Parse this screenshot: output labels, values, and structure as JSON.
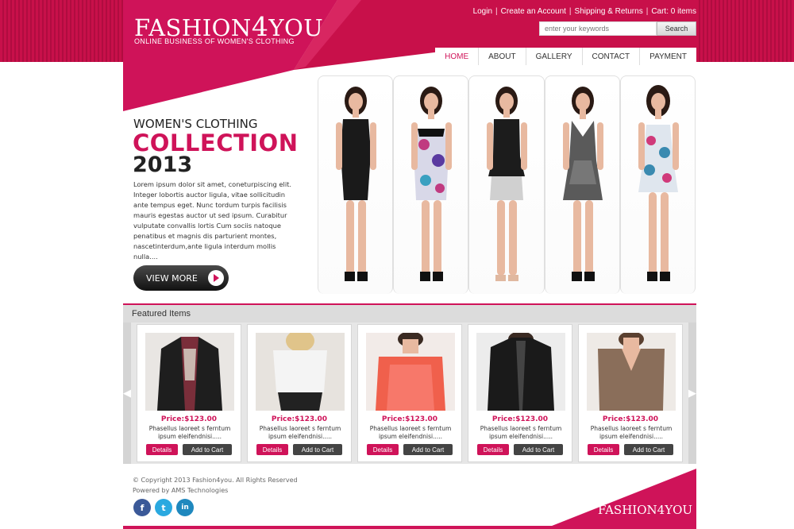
{
  "brand": {
    "name_part1": "FASHION",
    "name_four": "4",
    "name_part2": "YOU",
    "tagline": "ONLINE BUSINESS OF WOMEN'S CLOTHING",
    "footer_logo_part1": "FASHION",
    "footer_logo_four": "4",
    "footer_logo_part2": "YOU"
  },
  "toplinks": [
    "Login",
    "Create an Account",
    "Shipping & Returns",
    "Cart: 0 items"
  ],
  "search": {
    "placeholder": "enter your keywords",
    "button": "Search"
  },
  "nav": [
    "HOME",
    "ABOUT",
    "GALLERY",
    "CONTACT",
    "PAYMENT"
  ],
  "nav_active": "HOME",
  "hero": {
    "line1": "WOMEN'S CLOTHING",
    "line2": "COLLECTION",
    "line3": "2013",
    "body": "Lorem ipsum dolor sit amet, coneturpiscing elit. Integer lobortis auctor ligula, vitae sollicitudin ante tempus eget. Nunc tordum turpis facilisis mauris egestas auctor ut sed ipsum. Curabitur vulputate convallis lortis Cum sociis natoque penatibus et magnis dis parturient montes, nascetinterdum,ante ligula interdum mollis nulla....",
    "button": "VIEW MORE"
  },
  "featured": {
    "title": "Featured Items",
    "products": [
      {
        "price": "Price:$123.00",
        "desc_line1": "Phasellus laoreet s ferntum",
        "desc_line2": "ipsum eleifendnisi.....",
        "details": "Details",
        "cart": "Add to Cart"
      },
      {
        "price": "Price:$123.00",
        "desc_line1": "Phasellus laoreet s ferntum",
        "desc_line2": "ipsum eleifendnisi.....",
        "details": "Details",
        "cart": "Add to Cart"
      },
      {
        "price": "Price:$123.00",
        "desc_line1": "Phasellus laoreet s ferntum",
        "desc_line2": "ipsum eleifendnisi.....",
        "details": "Details",
        "cart": "Add to Cart"
      },
      {
        "price": "Price:$123.00",
        "desc_line1": "Phasellus laoreet s ferntum",
        "desc_line2": "ipsum eleifendnisi.....",
        "details": "Details",
        "cart": "Add to Cart"
      },
      {
        "price": "Price:$123.00",
        "desc_line1": "Phasellus laoreet s ferntum",
        "desc_line2": "ipsum eleifendnisi.....",
        "details": "Details",
        "cart": "Add to Cart"
      }
    ]
  },
  "footer": {
    "copyright": "© Copyright 2013 Fashion4you. All Rights Reserved",
    "powered": "Powered by AMS Technologies",
    "social": [
      {
        "icon": "facebook-icon",
        "glyph": "f",
        "color": "#3b5998"
      },
      {
        "icon": "twitter-icon",
        "glyph": "t",
        "color": "#2aa9e0"
      },
      {
        "icon": "linkedin-icon",
        "glyph": "in",
        "color": "#1f88be"
      }
    ]
  },
  "colors": {
    "accent": "#cf1359",
    "dark": "#222222"
  }
}
